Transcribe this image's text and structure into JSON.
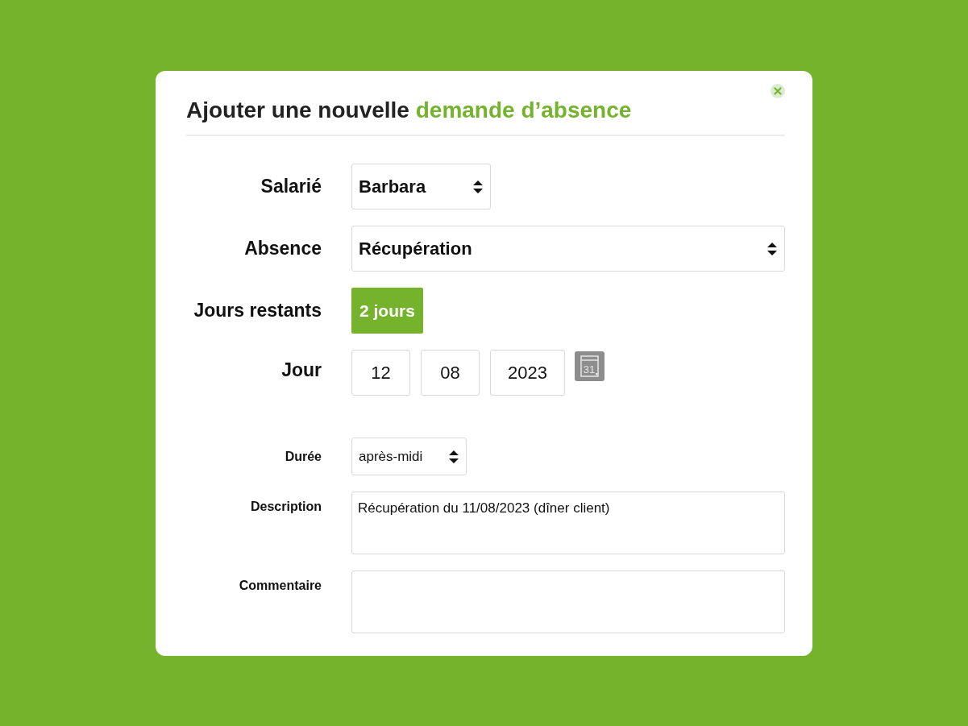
{
  "dialog": {
    "title": "Ajouter une nouvelle",
    "title_highlight": "demande d’absence"
  },
  "fields": [
    {
      "kind": "select",
      "label": "Salarié",
      "value": "Barbara"
    },
    {
      "kind": "select",
      "label": "Absence",
      "value": "Récupération"
    },
    {
      "kind": "badge",
      "label": "Jours restants",
      "value": "2 jours"
    },
    {
      "kind": "date",
      "label": "Jour",
      "day": "12",
      "month": "08",
      "year": "2023",
      "calendar_day": "31"
    },
    {
      "kind": "select",
      "label": "Durée",
      "value": "après-midi"
    },
    {
      "kind": "textarea",
      "label": "Description",
      "value": "Récupération du 11/08/2023 (dîner client)"
    },
    {
      "kind": "textarea",
      "label": "Commentaire"
    }
  ]
}
